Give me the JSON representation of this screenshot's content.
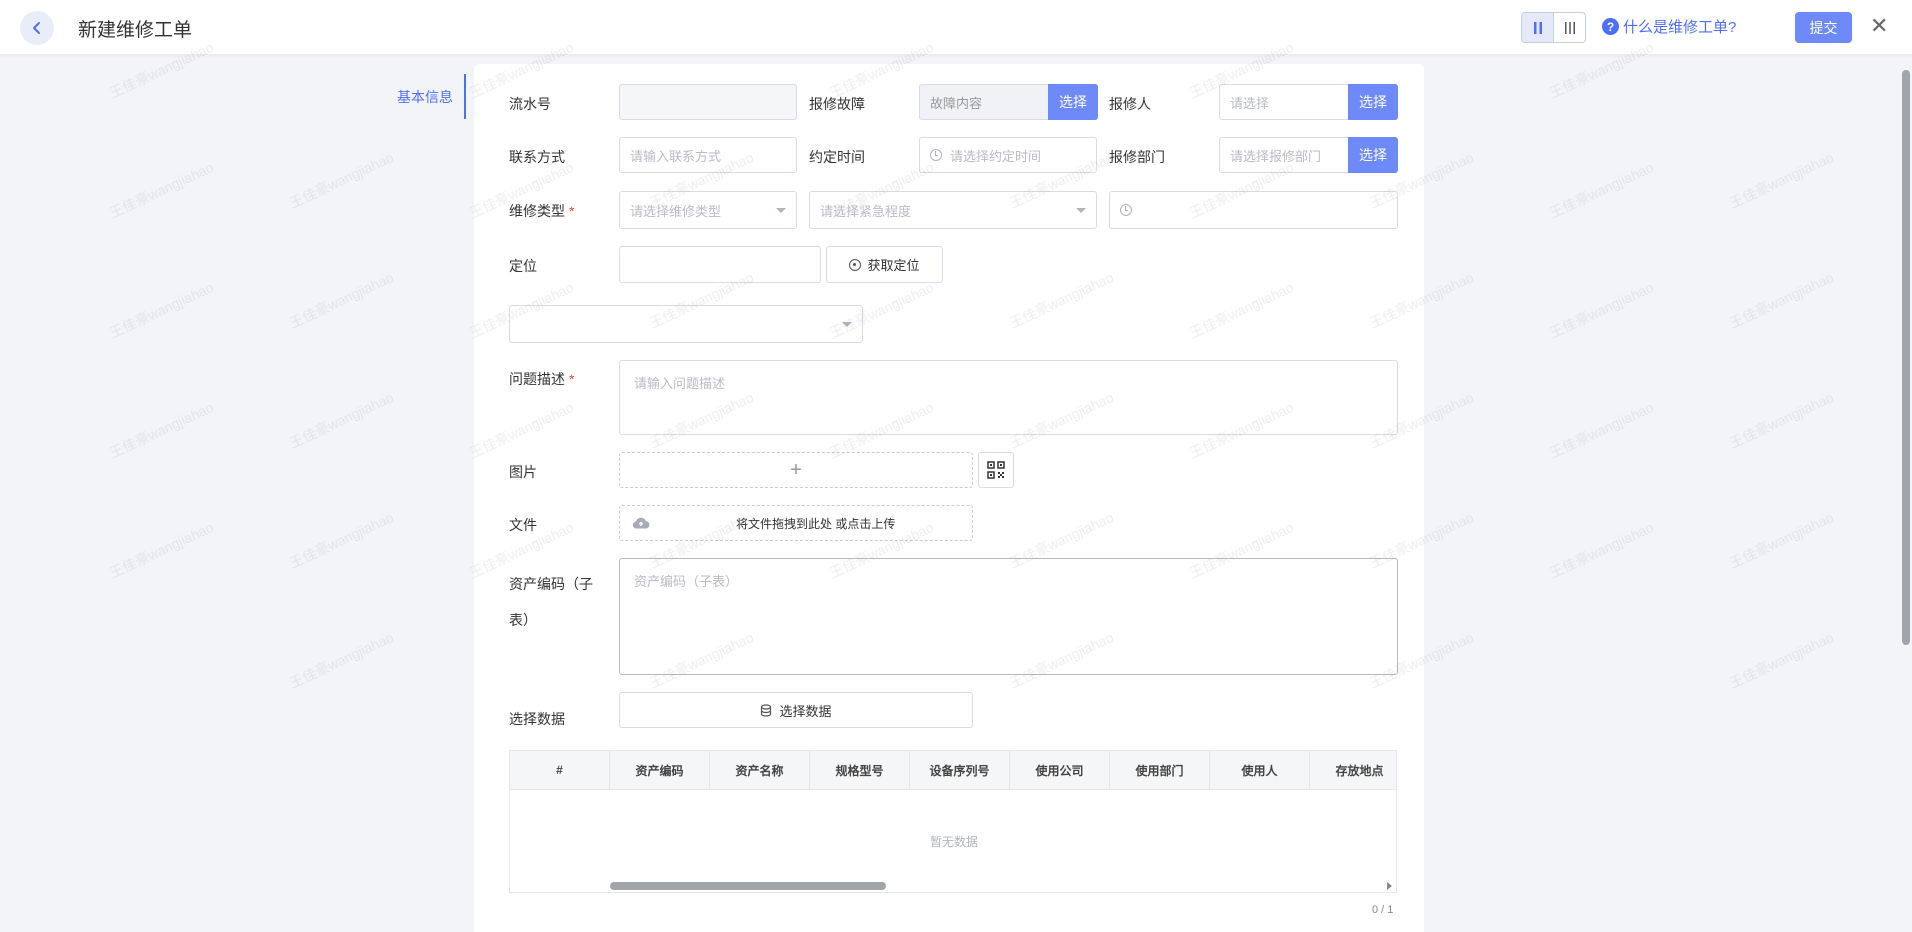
{
  "header": {
    "title": "新建维修工单",
    "help_text": "什么是维修工单?",
    "help_icon_glyph": "?",
    "submit_label": "提交",
    "close_glyph": "✕"
  },
  "side_nav": {
    "items": [
      {
        "label": "基本信息",
        "active": true
      }
    ]
  },
  "form": {
    "serial_no": {
      "label": "流水号",
      "value": ""
    },
    "fault": {
      "label": "报修故障",
      "placeholder": "故障内容",
      "button": "选择"
    },
    "reporter": {
      "label": "报修人",
      "placeholder": "请选择",
      "button": "选择"
    },
    "contact": {
      "label": "联系方式",
      "placeholder": "请输入联系方式"
    },
    "appointment": {
      "label": "约定时间",
      "placeholder": "请选择约定时间"
    },
    "department": {
      "label": "报修部门",
      "placeholder": "请选择报修部门",
      "button": "选择"
    },
    "repair_type": {
      "label": "维修类型",
      "required_mark": "*",
      "placeholder": "请选择维修类型"
    },
    "urgency": {
      "placeholder": "请选择紧急程度"
    },
    "location": {
      "label": "定位",
      "value": "",
      "button": "获取定位"
    },
    "description": {
      "label": "问题描述",
      "required_mark": "*",
      "placeholder": "请输入问题描述"
    },
    "image": {
      "label": "图片",
      "upload_glyph": "+"
    },
    "file": {
      "label": "文件",
      "upload_text": "将文件拖拽到此处 或点击上传"
    },
    "asset_code": {
      "label_line1": "资产编码（子",
      "label_line2": "表）",
      "placeholder": "资产编码（子表）"
    },
    "select_data": {
      "label": "选择数据",
      "button": "选择数据"
    }
  },
  "table": {
    "columns": [
      "#",
      "资产编码",
      "资产名称",
      "规格型号",
      "设备序列号",
      "使用公司",
      "使用部门",
      "使用人",
      "存放地点"
    ],
    "empty_text": "暂无数据",
    "pager": "0 / 1"
  },
  "watermark_text": "王佳豪wangjiahao",
  "colors": {
    "accent": "#6d8af8",
    "link": "#4f6ef7",
    "required": "#e54545"
  }
}
